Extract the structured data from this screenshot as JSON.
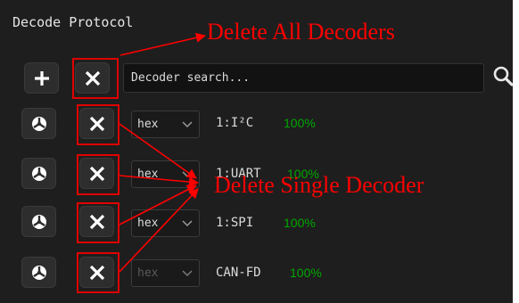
{
  "panel": {
    "title": "Decode Protocol"
  },
  "toolbar": {
    "add_icon": "plus-icon",
    "delete_all_icon": "close-icon",
    "search_placeholder": "Decoder search...",
    "search_icon": "search-icon"
  },
  "decoders": [
    {
      "format": "hex",
      "name": "1:I²C",
      "progress": "100%",
      "enabled": true
    },
    {
      "format": "hex",
      "name": "1:UART",
      "progress": "100%",
      "enabled": true
    },
    {
      "format": "hex",
      "name": "1:SPI",
      "progress": "100%",
      "enabled": true
    },
    {
      "format": "hex",
      "name": "CAN-FD",
      "progress": "100%",
      "enabled": false
    }
  ],
  "annotations": {
    "delete_all": "Delete All Decoders",
    "delete_single": "Delete Single Decoder"
  },
  "colors": {
    "panel_bg": "#1e1e1e",
    "annotation_red": "#ff0000",
    "progress_green": "#00a800"
  }
}
